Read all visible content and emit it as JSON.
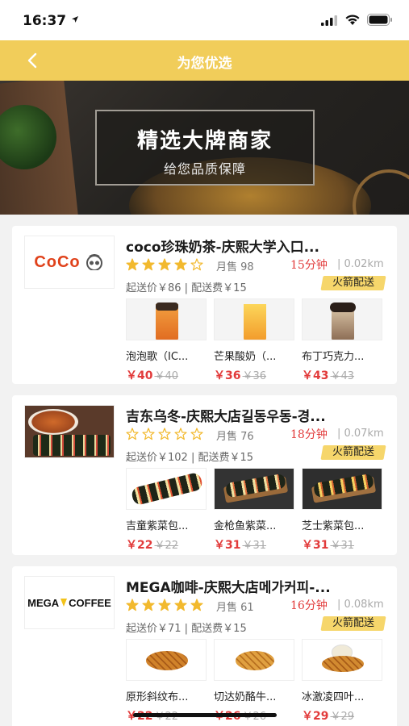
{
  "status_bar": {
    "time": "16:37"
  },
  "navbar": {
    "title": "为您优选"
  },
  "banner": {
    "title": "精选大牌商家",
    "subtitle": "给您品质保障"
  },
  "colors": {
    "brand_yellow": "#f1cd5a",
    "price_red": "#e23b3b",
    "star_gold": "#f2b92e"
  },
  "shops": [
    {
      "logo_text": "CoCo",
      "name": "coco珍珠奶茶-庆熙大学入口...",
      "rating": 4,
      "sales": "月售 98",
      "delivery_time": "15分钟",
      "distance": "| 0.02km",
      "fees": "起送价￥86 | 配送费￥15",
      "badge": "火箭配送",
      "products": [
        {
          "name": "泡泡歌（IC...",
          "price": "￥40",
          "old_price": "￥40"
        },
        {
          "name": "芒果酸奶（...",
          "price": "￥36",
          "old_price": "￥36"
        },
        {
          "name": "布丁巧克力...",
          "price": "￥43",
          "old_price": "￥43"
        }
      ]
    },
    {
      "name": "吉东乌冬-庆熙大店길동우동-경...",
      "rating": 0,
      "sales": "月售 76",
      "delivery_time": "18分钟",
      "distance": "| 0.07km",
      "fees": "起送价￥102 | 配送费￥15",
      "badge": "火箭配送",
      "products": [
        {
          "name": "吉童紫菜包...",
          "price": "￥22",
          "old_price": "￥22"
        },
        {
          "name": "金枪鱼紫菜...",
          "price": "￥31",
          "old_price": "￥31"
        },
        {
          "name": "芝士紫菜包...",
          "price": "￥31",
          "old_price": "￥31"
        }
      ]
    },
    {
      "logo_text_1": "MEGA",
      "logo_text_2": "COFFEE",
      "name": "MEGA咖啡-庆熙大店메가커피-...",
      "rating": 5,
      "sales": "月售 61",
      "delivery_time": "16分钟",
      "distance": "| 0.08km",
      "fees": "起送价￥71 | 配送费￥15",
      "badge": "火箭配送",
      "products": [
        {
          "name": "原形斜纹布...",
          "price": "￥22",
          "old_price": "￥22"
        },
        {
          "name": "切达奶酪牛...",
          "price": "￥26",
          "old_price": "￥26"
        },
        {
          "name": "冰激凌四叶...",
          "price": "￥29",
          "old_price": "￥29"
        }
      ]
    }
  ]
}
